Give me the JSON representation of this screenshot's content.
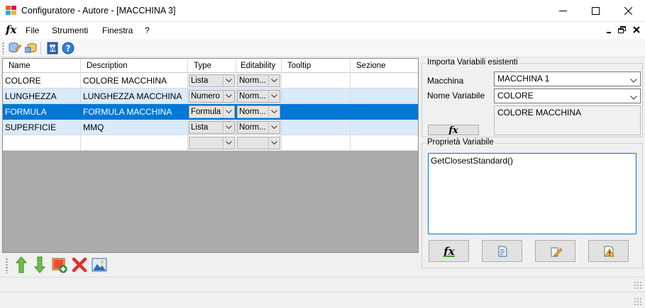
{
  "window": {
    "title": "Configuratore - Autore - [MACCHINA 3]"
  },
  "menu": {
    "fx_icon": "fx",
    "items": [
      "File",
      "Strumenti",
      "Finestra",
      "?"
    ]
  },
  "toolbar": {
    "icons": [
      "database-edit-icon",
      "database-import-icon",
      "word-document-icon",
      "help-icon"
    ]
  },
  "grid": {
    "columns": [
      "Name",
      "Description",
      "Type",
      "Editability",
      "Tooltip",
      "Sezione"
    ],
    "rows": [
      {
        "name": "COLORE",
        "description": "COLORE MACCHINA",
        "type": "Lista",
        "editability": "Norm...",
        "tooltip": "",
        "sezione": "",
        "style": "white"
      },
      {
        "name": "LUNGHEZZA",
        "description": "LUNGHEZZA MACCHINA",
        "type": "Numero",
        "editability": "Norm...",
        "tooltip": "",
        "sezione": "",
        "style": "alt"
      },
      {
        "name": "FORMULA",
        "description": "FORMULA MACCHINA",
        "type": "Formula",
        "editability": "Norm...",
        "tooltip": "",
        "sezione": "",
        "style": "selected"
      },
      {
        "name": "SUPERFICIE",
        "description": "MMQ",
        "type": "Lista",
        "editability": "Norm...",
        "tooltip": "",
        "sezione": "",
        "style": "alt"
      },
      {
        "name": "",
        "description": "",
        "type": "",
        "editability": "",
        "tooltip": "",
        "sezione": "",
        "style": "white"
      }
    ]
  },
  "grid_toolbar": {
    "icons": [
      "move-up-arrow-icon",
      "move-down-arrow-icon",
      "add-image-icon",
      "delete-x-icon",
      "picture-icon"
    ]
  },
  "import_group": {
    "title": "Importa Variabili esistenti",
    "macchina_label": "Macchina",
    "macchina_value": "MACCHINA 1",
    "nome_label": "Nome Variabile",
    "nome_value": "COLORE",
    "description_value": "COLORE MACCHINA",
    "fx_button": "fx"
  },
  "properties_group": {
    "title": "Proprietà Variabile",
    "formula_text": "GetClosestStandard()",
    "buttons": [
      "fx-button",
      "edit-document-button",
      "edit-pencil-button",
      "warning-button"
    ]
  },
  "colors": {
    "selection": "#0078d7",
    "alt_row": "#d9eafa",
    "grid_bg": "#ababab"
  }
}
